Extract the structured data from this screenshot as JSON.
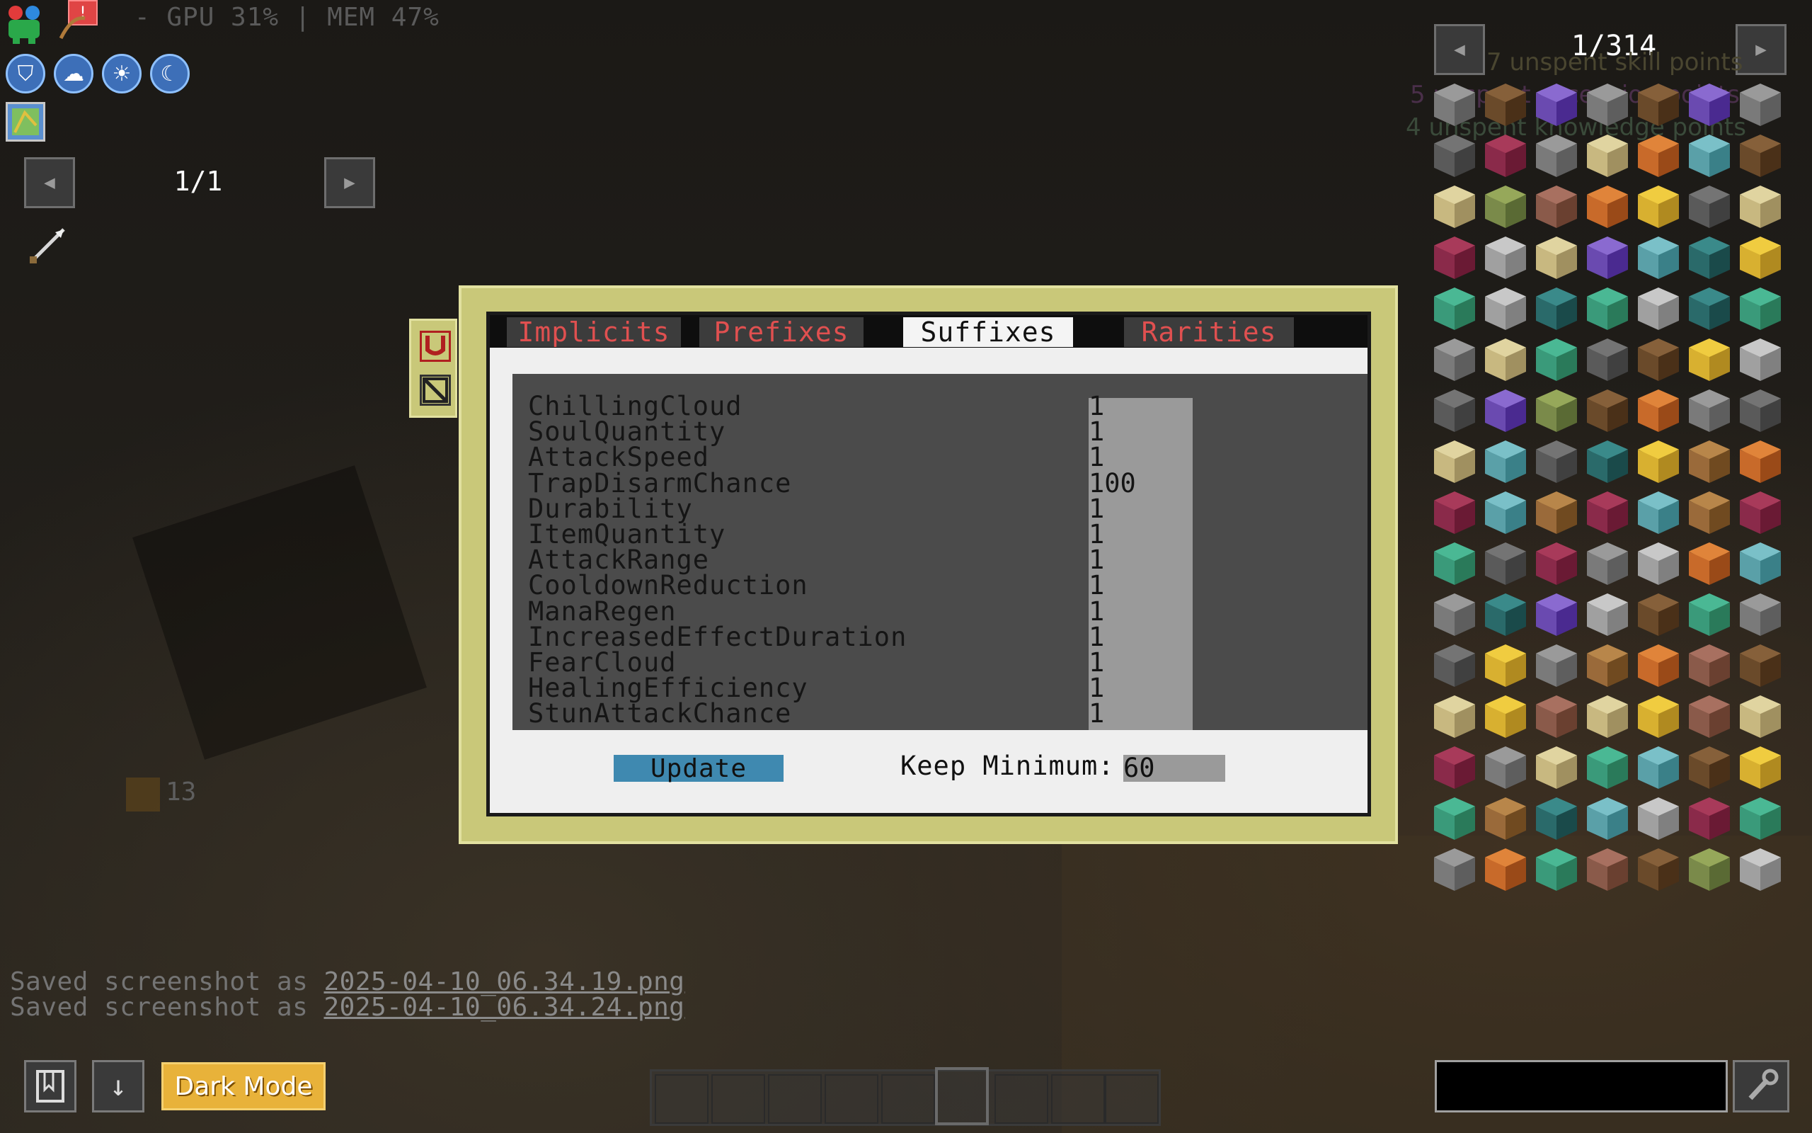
{
  "hud": {
    "stats_text": "- GPU 31% | MEM 47%",
    "left_pager": {
      "page": "1/1"
    },
    "item_counter": "13"
  },
  "dialog": {
    "tabs": [
      {
        "label": "Implicits",
        "active": false
      },
      {
        "label": "Prefixes",
        "active": false
      },
      {
        "label": "Suffixes",
        "active": true
      },
      {
        "label": "Rarities",
        "active": false
      }
    ],
    "rows": [
      {
        "name": "ChillingCloud",
        "value": "1"
      },
      {
        "name": "SoulQuantity",
        "value": "1"
      },
      {
        "name": "AttackSpeed",
        "value": "1"
      },
      {
        "name": "TrapDisarmChance",
        "value": "100"
      },
      {
        "name": "Durability",
        "value": "1"
      },
      {
        "name": "ItemQuantity",
        "value": "1"
      },
      {
        "name": "AttackRange",
        "value": "1"
      },
      {
        "name": "CooldownReduction",
        "value": "1"
      },
      {
        "name": "ManaRegen",
        "value": "1"
      },
      {
        "name": "IncreasedEffectDuration",
        "value": "1"
      },
      {
        "name": "FearCloud",
        "value": "1"
      },
      {
        "name": "HealingEfficiency",
        "value": "1"
      },
      {
        "name": "StunAttackChance",
        "value": "1"
      }
    ],
    "update_label": "Update",
    "keep_minimum_label": "Keep Minimum:",
    "keep_minimum_value": "60"
  },
  "item_panel": {
    "page": "1/314",
    "ghost_lines": [
      "7 unspent skill points",
      "5 unspent ascension points",
      "4 unspent knowledge points"
    ]
  },
  "chat": [
    {
      "prefix": "Saved screenshot as ",
      "file": "2025-04-10_06.34.19.png"
    },
    {
      "prefix": "Saved screenshot as ",
      "file": "2025-04-10_06.34.24.png"
    }
  ],
  "bottom": {
    "dark_mode_label": "Dark Mode"
  },
  "colors": {
    "dialog_frame": "#c9c879",
    "tab_inactive_text": "#e05050",
    "update_button": "#3f89b0",
    "dark_mode_button": "#e8b23a"
  }
}
